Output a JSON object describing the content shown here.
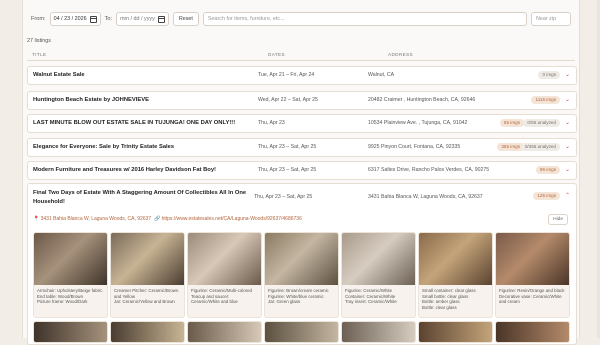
{
  "filters": {
    "from_label": "From:",
    "from_value": "04 / 23 / 2026",
    "to_label": "To:",
    "to_value": "mm / dd / yyyy",
    "reset_label": "Reset",
    "search_placeholder": "Search for items, furniture, etc...",
    "near_zip_placeholder": "Near zip"
  },
  "listing_count": "27 listings",
  "columns": {
    "title": "TITLE",
    "dates": "DATES",
    "address": "ADDRESS"
  },
  "rows": [
    {
      "title": "Walnut Estate Sale",
      "dates": "Tue, Apr 21 – Fri, Apr 24",
      "address": "Walnut, CA",
      "badge1": "0 imgs",
      "badge2": ""
    },
    {
      "title": "Huntington Beach Estate by JOHNEVIEVE",
      "dates": "Wed, Apr 22 – Sat, Apr 25",
      "address": "20482 Craimer , Huntington Beach, CA, 92646",
      "badge1": "1115 imgs",
      "badge2": ""
    },
    {
      "title": "LAST MINUTE BLOW OUT ESTATE SALE IN TUJUNGA! ONE DAY ONLY!!!",
      "dates": "Thu, Apr 23",
      "address": "10534 Plainview Ave. , Tujunga, CA, 91042",
      "badge1": "55 imgs",
      "badge2": "0/55 analyzed"
    },
    {
      "title": "Elegance for Everyone: Sale by Trinity Estate Sales",
      "dates": "Thu, Apr 23 – Sat, Apr 25",
      "address": "9925 Pinyon Court, Fontana, CA, 92335",
      "badge1": "355 imgs",
      "badge2": "0/355 analyzed"
    },
    {
      "title": "Modern Furniture and Treasures w/ 2016 Harley Davidson Fat Boy!",
      "dates": "Thu, Apr 23 – Sat, Apr 25",
      "address": "6317 Saltes Drive, Rancho Palos Verdes, CA, 90275",
      "badge1": "96 imgs",
      "badge2": ""
    }
  ],
  "expanded": {
    "title": "Final Two Days of Estate With A Staggering Amount Of Collectibles All In One Household!",
    "dates": "Thu, Apr 23 – Sat, Apr 25",
    "address": "3431 Bahia Blanca W, Laguna Woods, CA, 92637",
    "badge": "125 imgs",
    "map_link": "3431 Bahia Blanca W, Laguna Woods, CA, 92637",
    "url_link": "https://www.estatesales.net/CA/Laguna-Woods/92637/4686736",
    "hide_label": "Hide",
    "cards": [
      {
        "lines": [
          "Armchair: Upholstery/Beige fabric",
          "End table: Wood/Brown",
          "Picture frame: Wood/Dark"
        ],
        "colors": [
          "#6b5848",
          "#a6927c",
          "#3f332a"
        ]
      },
      {
        "lines": [
          "Creamer Pitcher: Ceramic/Brown and Yellow",
          "Jar: Ceramic/Yellow and Brown"
        ],
        "colors": [
          "#7a6a5a",
          "#c8b494",
          "#4a3d31"
        ]
      },
      {
        "lines": [
          "Figurine: Ceramic/Multi-colored",
          "Teacup and saucer: Ceramic/White and blue"
        ],
        "colors": [
          "#9a8a7a",
          "#d8c8b8",
          "#6a5a4a"
        ]
      },
      {
        "lines": [
          "Figurine: Brown/cream ceramic",
          "Figurine: White/blue ceramic",
          "Jar: Green glass"
        ],
        "colors": [
          "#8a7a62",
          "#c4b6a2",
          "#5c5040"
        ]
      },
      {
        "lines": [
          "Figurine: Ceramic/White",
          "Container: Ceramic/White",
          "Tray insert: Ceramic/White"
        ],
        "colors": [
          "#a89a8a",
          "#d6ccc0",
          "#6c6054"
        ]
      },
      {
        "lines": [
          "Small container: clear glass",
          "Small bottle: clear glass",
          "Bottle: amber glass",
          "Bottle: clear glass"
        ],
        "colors": [
          "#8a6a4a",
          "#c4a47a",
          "#5a4330"
        ]
      },
      {
        "lines": [
          "Figurine: Resin/Orange and black",
          "Decorative vase: Ceramic/White and cream"
        ],
        "colors": [
          "#7a5a4a",
          "#b48a6a",
          "#4a3528"
        ]
      }
    ]
  }
}
